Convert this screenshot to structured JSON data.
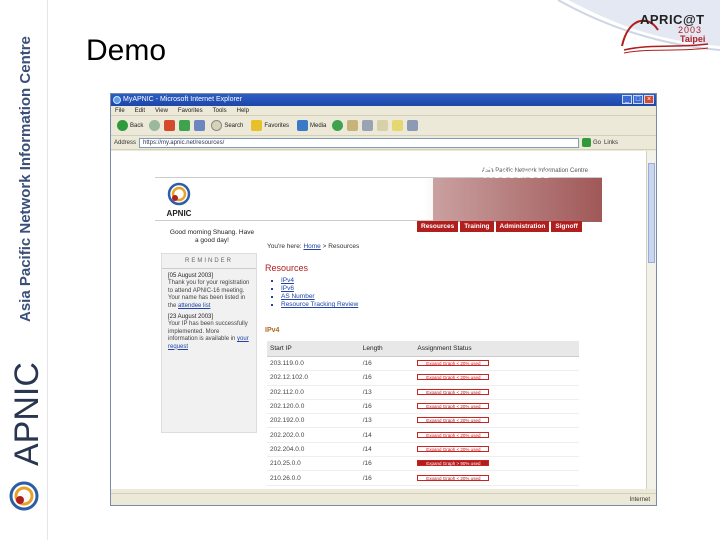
{
  "slide": {
    "title": "Demo"
  },
  "sideband": {
    "org": "Asia Pacific Network Information Centre",
    "brand": "APNIC"
  },
  "conference": {
    "name": "APRIC@T",
    "year": "2003",
    "city": "Taipei"
  },
  "browser": {
    "title": "MyAPNIC - Microsoft Internet Explorer",
    "window_buttons": [
      "_",
      "□",
      "×"
    ],
    "menu": [
      "File",
      "Edit",
      "View",
      "Favorites",
      "Tools",
      "Help"
    ],
    "toolbar": {
      "back": "Back",
      "search": "Search",
      "favorites": "Favorites",
      "media": "Media"
    },
    "address_label": "Address",
    "address_value": "https://my.apnic.net/resources/",
    "go_label": "Go",
    "links_label": "Links",
    "status_text": "",
    "status_zone": "Internet"
  },
  "site": {
    "org_header": "Asia Pacific Network Information Centre",
    "logo_text": "APNIC",
    "banner_title": "Resources",
    "nav": [
      "Resources",
      "Training",
      "Administration",
      "Signoff"
    ],
    "greeting": "Good morning Shuang. Have a good day!",
    "reminder": {
      "heading": "REMINDER",
      "items": [
        {
          "date": "[05 August 2003]",
          "text": "Thank you for your registration to attend APNIC-16 meeting. Your name has been listed in the",
          "link": "attendee list"
        },
        {
          "date": "[23 August 2003]",
          "text": "Your IP has been successfully implemented. More information is available in",
          "link": "your request"
        }
      ]
    },
    "breadcrumb": {
      "prefix": "You're here:",
      "home": "Home",
      "sep": ">",
      "current": "Resources"
    },
    "resources_title": "Resources",
    "resource_links": [
      "IPv4",
      "IPv6",
      "AS Number",
      "Resource Tracking Review"
    ],
    "ipv4_label": "IPv4",
    "table": {
      "headers": [
        "Start IP",
        "Length",
        "Assignment Status"
      ],
      "rows": [
        {
          "ip": "203.119.0.0",
          "len": "/16",
          "status": "Expand Graph < 20% used",
          "full": false
        },
        {
          "ip": "202.12.102.0",
          "len": "/16",
          "status": "Expand Graph < 20% used",
          "full": false
        },
        {
          "ip": "202.112.0.0",
          "len": "/13",
          "status": "Expand Graph < 20% used",
          "full": false
        },
        {
          "ip": "202.120.0.0",
          "len": "/16",
          "status": "Expand Graph < 20% used",
          "full": false
        },
        {
          "ip": "202.192.0.0",
          "len": "/13",
          "status": "Expand Graph < 20% used",
          "full": false
        },
        {
          "ip": "202.202.0.0",
          "len": "/14",
          "status": "Expand Graph < 20% used",
          "full": false
        },
        {
          "ip": "202.204.0.0",
          "len": "/14",
          "status": "Expand Graph < 20% used",
          "full": false
        },
        {
          "ip": "210.25.0.0",
          "len": "/16",
          "status": "Expand Graph > 90% used",
          "full": true
        },
        {
          "ip": "210.26.0.0",
          "len": "/16",
          "status": "Expand Graph < 20% used",
          "full": false
        }
      ]
    }
  },
  "colors": {
    "accent": "#b01e1e",
    "ie_title": "#2c5ec4",
    "link": "#2044a8"
  }
}
